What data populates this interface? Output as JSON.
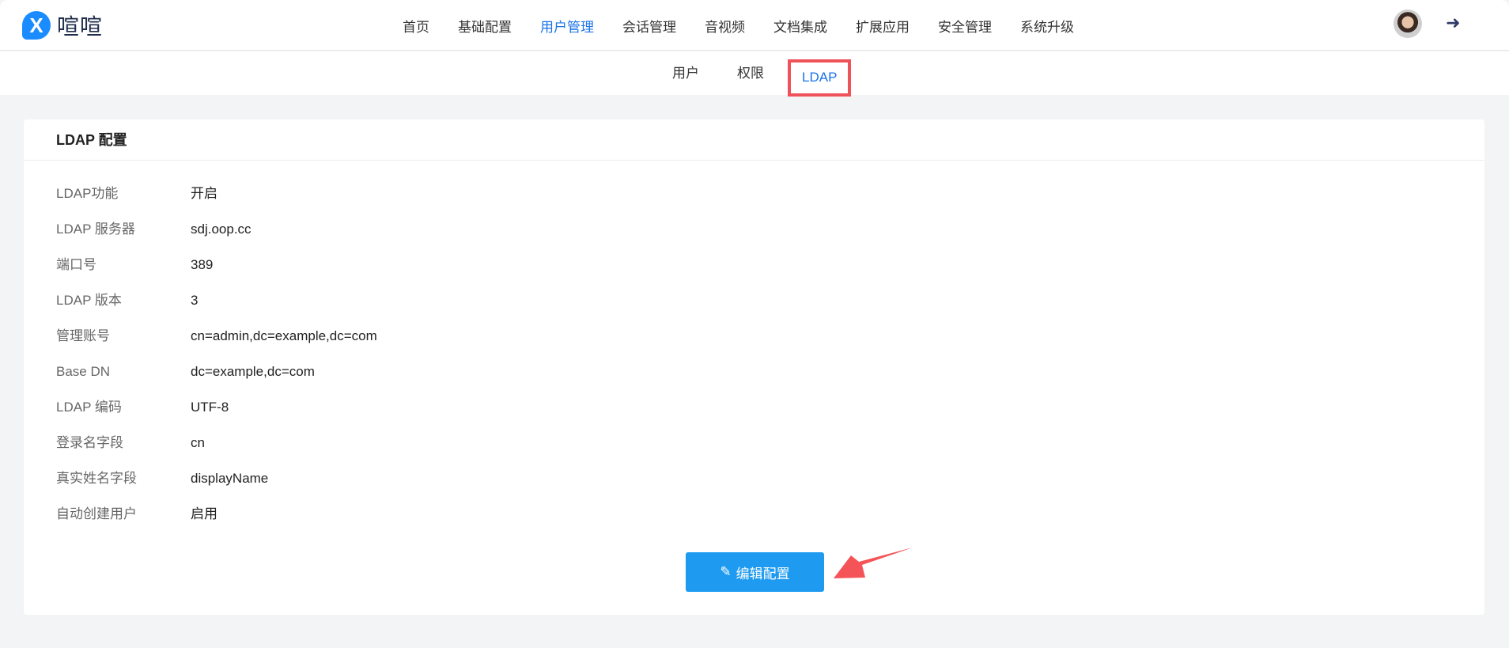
{
  "brand": {
    "name": "喧喧",
    "mark": "X"
  },
  "nav": [
    "首页",
    "基础配置",
    "用户管理",
    "会话管理",
    "音视频",
    "文档集成",
    "扩展应用",
    "安全管理",
    "系统升级"
  ],
  "nav_active": "用户管理",
  "subnav": [
    "用户",
    "权限",
    "LDAP"
  ],
  "card": {
    "title": "LDAP 配置",
    "rows": [
      {
        "label": "LDAP功能",
        "value": "开启"
      },
      {
        "label": "LDAP 服务器",
        "value": "sdj.oop.cc"
      },
      {
        "label": "端口号",
        "value": "389"
      },
      {
        "label": "LDAP 版本",
        "value": "3"
      },
      {
        "label": "管理账号",
        "value": "cn=admin,dc=example,dc=com"
      },
      {
        "label": "Base DN",
        "value": "dc=example,dc=com"
      },
      {
        "label": "LDAP 编码",
        "value": "UTF-8"
      },
      {
        "label": "登录名字段",
        "value": "cn"
      },
      {
        "label": "真实姓名字段",
        "value": "displayName"
      },
      {
        "label": "自动创建用户",
        "value": "启用"
      }
    ],
    "edit_button": "编辑配置"
  },
  "icons": {
    "edit": "✎",
    "logout": "➜"
  }
}
